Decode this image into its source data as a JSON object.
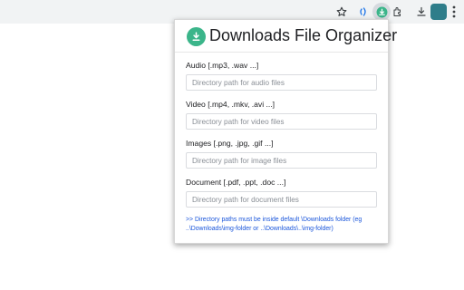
{
  "browser": {
    "toolbar_icons": [
      "star-icon",
      "extension-blue-icon",
      "downloads-organizer-extension-icon",
      "extensions-puzzle-icon",
      "downloads-icon",
      "profile-avatar",
      "more-menu-icon"
    ]
  },
  "popup": {
    "title": "Downloads File Organizer",
    "logo_icon": "download-circle-icon",
    "accent_color": "#3bb58a",
    "fields": [
      {
        "label": "Audio [.mp3, .wav ...]",
        "placeholder": "Directory path for audio files",
        "value": ""
      },
      {
        "label": "Video [.mp4, .mkv, .avi ...]",
        "placeholder": "Directory path for video files",
        "value": ""
      },
      {
        "label": "Images [.png, .jpg, .gif ...]",
        "placeholder": "Directory path for image files",
        "value": ""
      },
      {
        "label": "Document [.pdf, .ppt, .doc ...]",
        "placeholder": "Directory path for document files",
        "value": ""
      }
    ],
    "note": ">> Directory paths must be inside default \\Downloads folder (eg ..\\Downloads\\img-folder or ..\\Downloads\\..\\img-folder)",
    "note_color": "#1a56db"
  }
}
